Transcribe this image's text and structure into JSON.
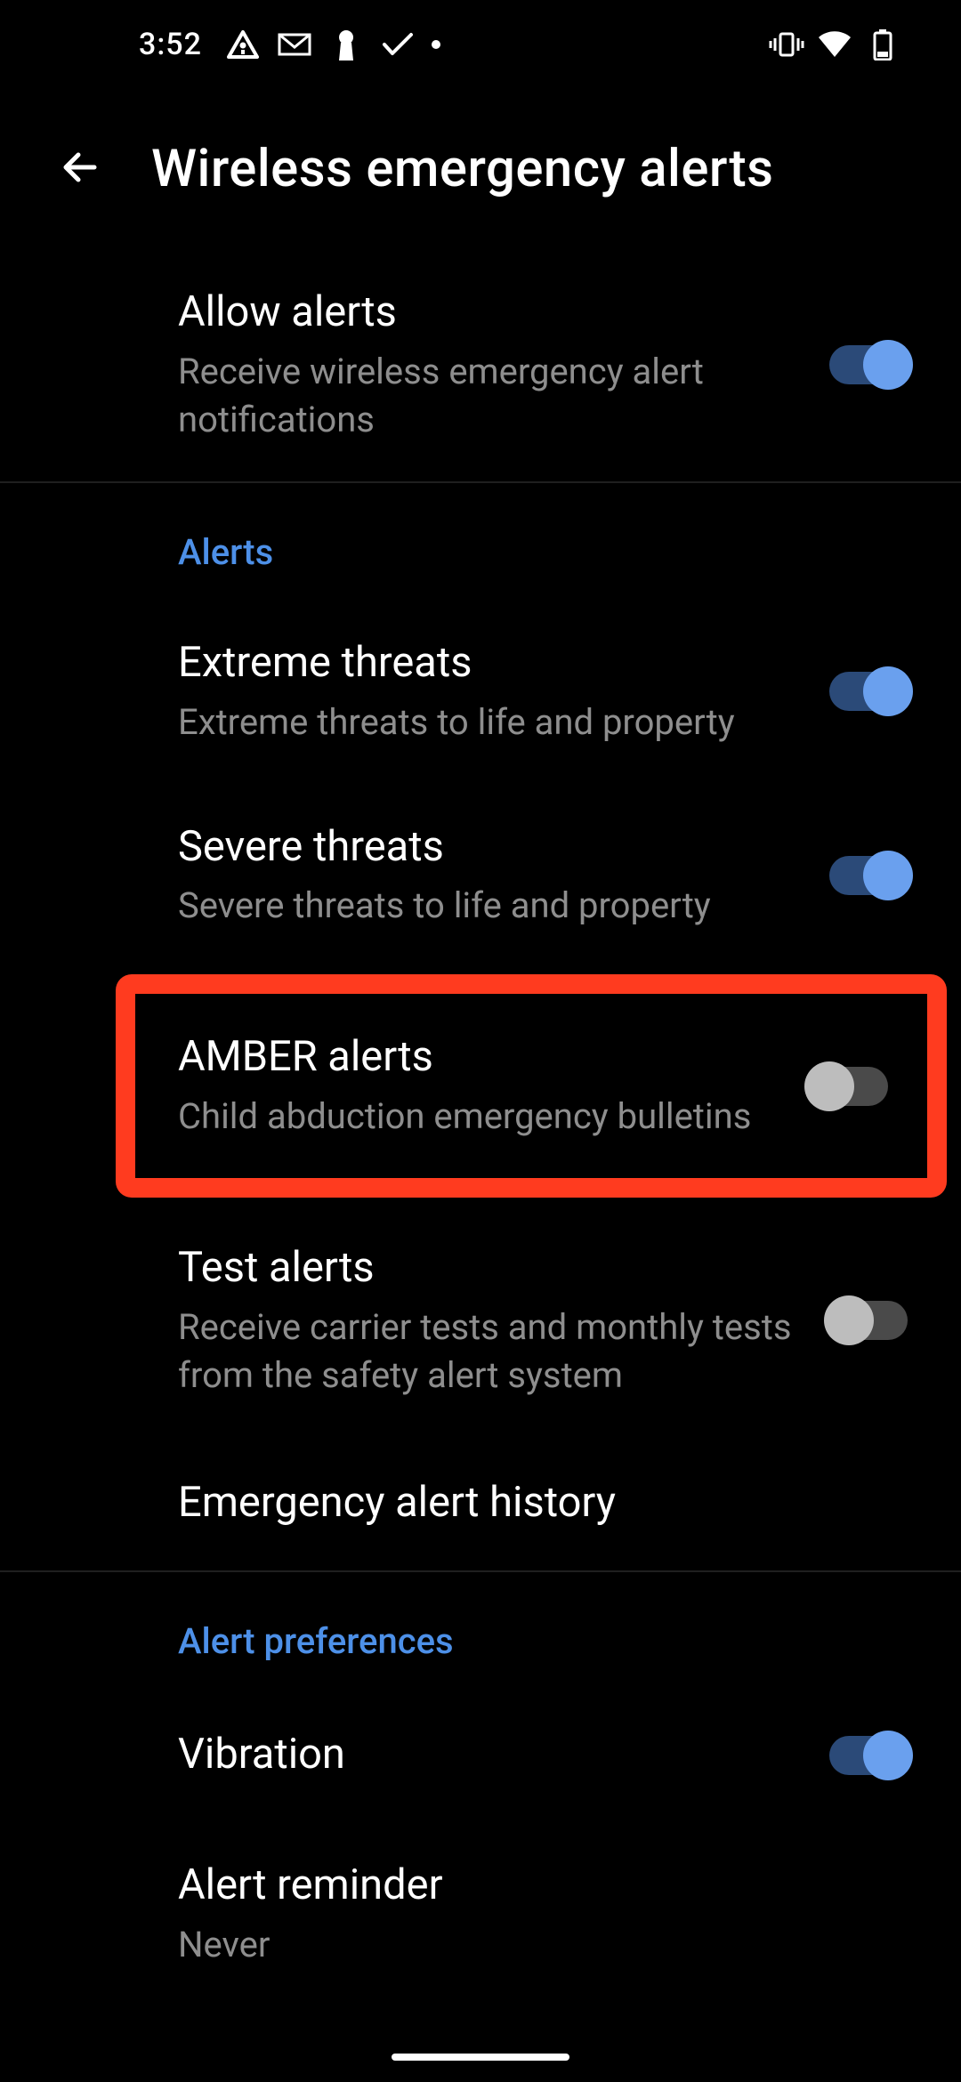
{
  "status_bar": {
    "time": "3:52"
  },
  "header": {
    "title": "Wireless emergency alerts"
  },
  "main": {
    "allow_alerts": {
      "title": "Allow alerts",
      "subtitle": "Receive wireless emergency alert notifications",
      "enabled": true
    }
  },
  "alerts_section": {
    "header": "Alerts",
    "extreme": {
      "title": "Extreme threats",
      "subtitle": "Extreme threats to life and property",
      "enabled": true
    },
    "severe": {
      "title": "Severe threats",
      "subtitle": "Severe threats to life and property",
      "enabled": true
    },
    "amber": {
      "title": "AMBER alerts",
      "subtitle": "Child abduction emergency bulletins",
      "enabled": false
    },
    "test": {
      "title": "Test alerts",
      "subtitle": "Receive carrier tests and monthly tests from the safety alert system",
      "enabled": false
    },
    "history": {
      "title": "Emergency alert history"
    }
  },
  "preferences_section": {
    "header": "Alert preferences",
    "vibration": {
      "title": "Vibration",
      "enabled": true
    },
    "reminder": {
      "title": "Alert reminder",
      "subtitle": "Never"
    }
  }
}
